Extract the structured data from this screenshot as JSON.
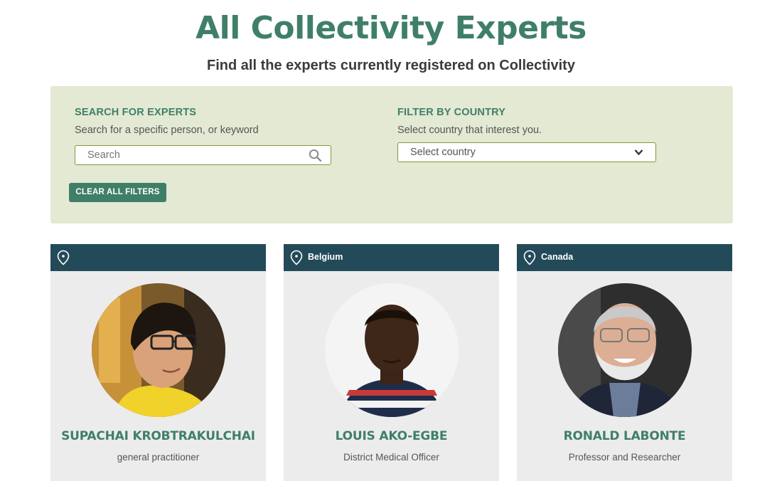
{
  "header": {
    "title": "All Collectivity Experts",
    "subtitle": "Find all the experts currently registered on Collectivity"
  },
  "filters": {
    "search": {
      "heading": "SEARCH FOR EXPERTS",
      "description": "Search for a specific person, or keyword",
      "placeholder": "Search",
      "value": "",
      "icon": "search-icon"
    },
    "country": {
      "heading": "FILTER BY COUNTRY",
      "description": "Select country that interest you.",
      "selected": "Select country",
      "icon": "chevron-down-icon"
    },
    "clear_label": "CLEAR ALL FILTERS"
  },
  "experts": [
    {
      "country": "",
      "name": "SUPACHAI KROBTRAKULCHAI",
      "role": "general practitioner"
    },
    {
      "country": "Belgium",
      "name": "LOUIS AKO-EGBE",
      "role": "District Medical Officer"
    },
    {
      "country": "Canada",
      "name": "RONALD LABONTE",
      "role": "Professor and Researcher"
    }
  ],
  "colors": {
    "accent": "#3f7f68",
    "panel": "#e3e9d2",
    "card_header": "#234a58",
    "card_bg": "#ececec",
    "input_border": "#7d9a3c"
  }
}
